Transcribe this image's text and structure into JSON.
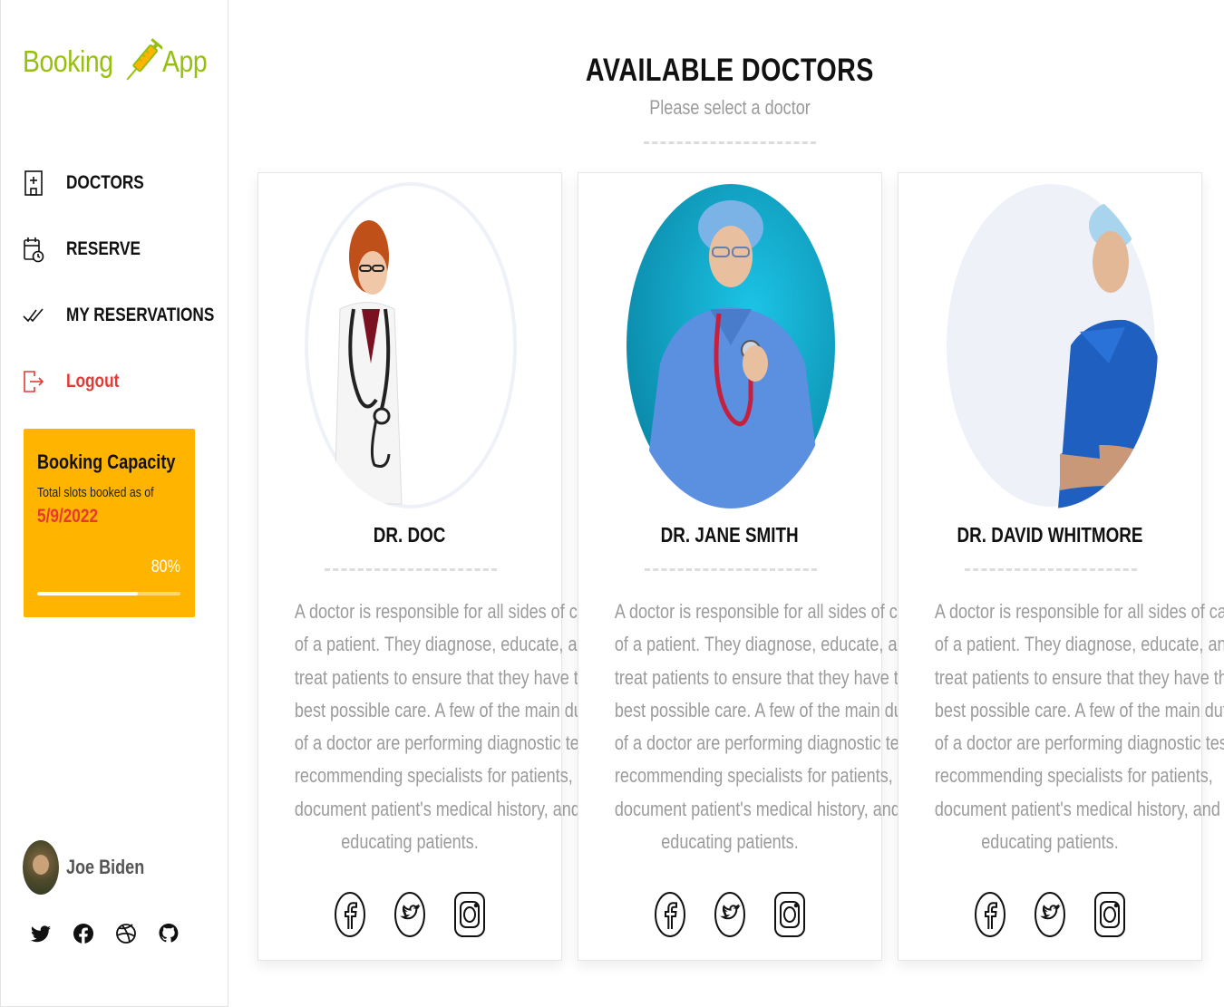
{
  "app": {
    "logo_left": "Booking",
    "logo_right": "App"
  },
  "nav": {
    "items": [
      {
        "label": "DOCTORS",
        "icon": "hospital-icon"
      },
      {
        "label": "RESERVE",
        "icon": "calendar-clock-icon"
      },
      {
        "label": "MY RESERVATIONS",
        "icon": "double-check-icon"
      },
      {
        "label": "Logout",
        "icon": "logout-icon"
      }
    ]
  },
  "capacity": {
    "title": "Booking Capacity",
    "subtitle": "Total slots booked as of",
    "date": "5/9/2022",
    "percent_label": "80%",
    "percent_value": 0.7
  },
  "user": {
    "name": "Joe Biden"
  },
  "sidebar_social": [
    "twitter-icon",
    "facebook-icon",
    "dribbble-icon",
    "github-icon"
  ],
  "main": {
    "title": "AVAILABLE DOCTORS",
    "subtitle": "Please select a doctor"
  },
  "doctors": [
    {
      "name": "DR. DOC",
      "description": [
        "A doctor is responsible for all sides of care",
        "of a patient. They diagnose, educate, and",
        "treat patients to ensure that they have the",
        "best possible care. A few of the main duties",
        "of a doctor are performing diagnostic tests,",
        "recommending specialists for patients,",
        "document patient's medical history, and",
        "educating patients."
      ]
    },
    {
      "name": "DR. JANE SMITH",
      "description": [
        "A doctor is responsible for all sides of care",
        "of a patient. They diagnose, educate, and",
        "treat patients to ensure that they have the",
        "best possible care. A few of the main duties",
        "of a doctor are performing diagnostic tests,",
        "recommending specialists for patients,",
        "document patient's medical history, and",
        "educating patients."
      ]
    },
    {
      "name": "DR. DAVID WHITMORE",
      "description": [
        "A doctor is responsible for all sides of care",
        "of a patient. They diagnose, educate, and",
        "treat patients to ensure that they have the",
        "best possible care. A few of the main duties",
        "of a doctor are performing diagnostic tests,",
        "recommending specialists for patients,",
        "document patient's medical history, and",
        "educating patients."
      ]
    }
  ],
  "colors": {
    "brand": "#97bf0d",
    "logout": "#e53935",
    "capacity_bg": "#ffb400",
    "capacity_date": "#e53935"
  }
}
